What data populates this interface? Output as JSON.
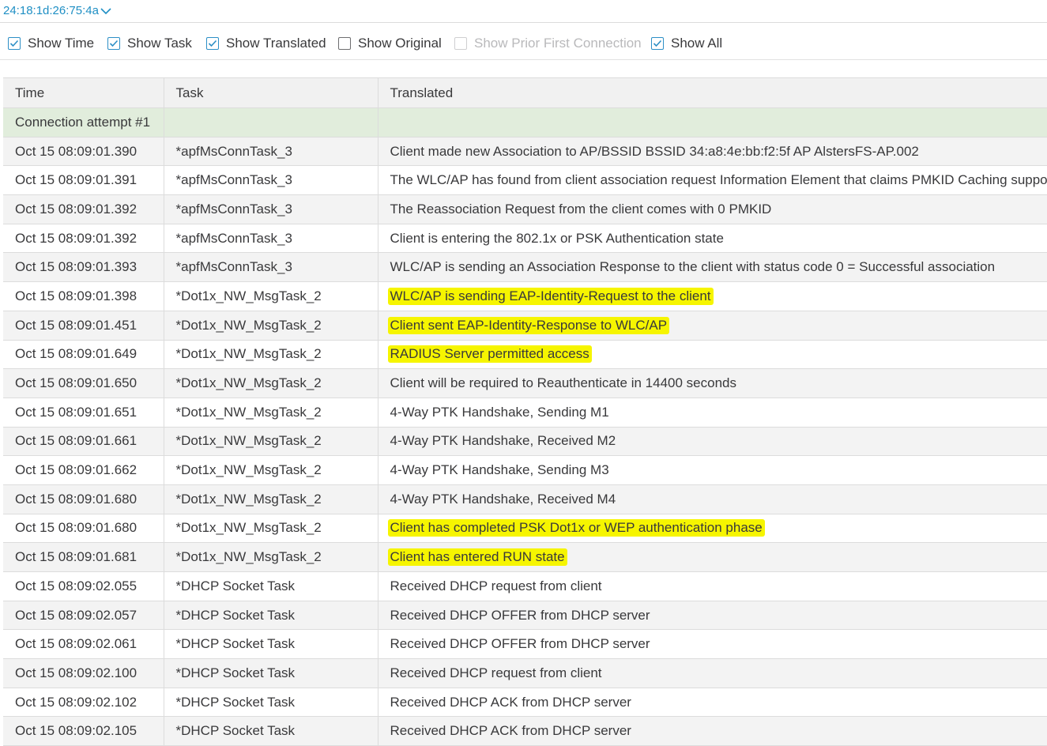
{
  "header": {
    "mac_address": "24:18:1d:26:75:4a"
  },
  "filters": [
    {
      "label": "Show Time",
      "checked": true,
      "disabled": false
    },
    {
      "label": "Show Task",
      "checked": true,
      "disabled": false
    },
    {
      "label": "Show Translated",
      "checked": true,
      "disabled": false
    },
    {
      "label": "Show Original",
      "checked": false,
      "disabled": false
    },
    {
      "label": "Show Prior First Connection",
      "checked": false,
      "disabled": true
    },
    {
      "label": "Show All",
      "checked": true,
      "disabled": false
    }
  ],
  "table": {
    "columns": [
      "Time",
      "Task",
      "Translated"
    ],
    "group_label": "Connection attempt #1",
    "highlight_color": "#f6f500",
    "rows": [
      {
        "time": "Oct 15 08:09:01.390",
        "task": "*apfMsConnTask_3",
        "translated": "Client made new Association to AP/BSSID BSSID 34:a8:4e:bb:f2:5f AP AlstersFS-AP.002",
        "highlighted": false
      },
      {
        "time": "Oct 15 08:09:01.391",
        "task": "*apfMsConnTask_3",
        "translated": "The WLC/AP has found from client association request Information Element that claims PMKID Caching support",
        "highlighted": false
      },
      {
        "time": "Oct 15 08:09:01.392",
        "task": "*apfMsConnTask_3",
        "translated": "The Reassociation Request from the client comes with 0 PMKID",
        "highlighted": false
      },
      {
        "time": "Oct 15 08:09:01.392",
        "task": "*apfMsConnTask_3",
        "translated": "Client is entering the 802.1x or PSK Authentication state",
        "highlighted": false
      },
      {
        "time": "Oct 15 08:09:01.393",
        "task": "*apfMsConnTask_3",
        "translated": "WLC/AP is sending an Association Response to the client with status code 0 = Successful association",
        "highlighted": false
      },
      {
        "time": "Oct 15 08:09:01.398",
        "task": "*Dot1x_NW_MsgTask_2",
        "translated": "WLC/AP is sending EAP-Identity-Request to the client",
        "highlighted": true
      },
      {
        "time": "Oct 15 08:09:01.451",
        "task": "*Dot1x_NW_MsgTask_2",
        "translated": "Client sent EAP-Identity-Response to WLC/AP",
        "highlighted": true
      },
      {
        "time": "Oct 15 08:09:01.649",
        "task": "*Dot1x_NW_MsgTask_2",
        "translated": "RADIUS Server permitted access",
        "highlighted": true
      },
      {
        "time": "Oct 15 08:09:01.650",
        "task": "*Dot1x_NW_MsgTask_2",
        "translated": "Client will be required to Reauthenticate in 14400 seconds",
        "highlighted": false
      },
      {
        "time": "Oct 15 08:09:01.651",
        "task": "*Dot1x_NW_MsgTask_2",
        "translated": "4-Way PTK Handshake, Sending M1",
        "highlighted": false
      },
      {
        "time": "Oct 15 08:09:01.661",
        "task": "*Dot1x_NW_MsgTask_2",
        "translated": "4-Way PTK Handshake, Received M2",
        "highlighted": false
      },
      {
        "time": "Oct 15 08:09:01.662",
        "task": "*Dot1x_NW_MsgTask_2",
        "translated": "4-Way PTK Handshake, Sending M3",
        "highlighted": false
      },
      {
        "time": "Oct 15 08:09:01.680",
        "task": "*Dot1x_NW_MsgTask_2",
        "translated": "4-Way PTK Handshake, Received M4",
        "highlighted": false
      },
      {
        "time": "Oct 15 08:09:01.680",
        "task": "*Dot1x_NW_MsgTask_2",
        "translated": "Client has completed PSK Dot1x or WEP authentication phase",
        "highlighted": true
      },
      {
        "time": "Oct 15 08:09:01.681",
        "task": "*Dot1x_NW_MsgTask_2",
        "translated": "Client has entered RUN state",
        "highlighted": true
      },
      {
        "time": "Oct 15 08:09:02.055",
        "task": "*DHCP Socket Task",
        "translated": "Received DHCP request from client",
        "highlighted": false
      },
      {
        "time": "Oct 15 08:09:02.057",
        "task": "*DHCP Socket Task",
        "translated": "Received DHCP OFFER from DHCP server",
        "highlighted": false
      },
      {
        "time": "Oct 15 08:09:02.061",
        "task": "*DHCP Socket Task",
        "translated": "Received DHCP OFFER from DHCP server",
        "highlighted": false
      },
      {
        "time": "Oct 15 08:09:02.100",
        "task": "*DHCP Socket Task",
        "translated": "Received DHCP request from client",
        "highlighted": false
      },
      {
        "time": "Oct 15 08:09:02.102",
        "task": "*DHCP Socket Task",
        "translated": "Received DHCP ACK from DHCP server",
        "highlighted": false
      },
      {
        "time": "Oct 15 08:09:02.105",
        "task": "*DHCP Socket Task",
        "translated": "Received DHCP ACK from DHCP server",
        "highlighted": false
      }
    ]
  }
}
